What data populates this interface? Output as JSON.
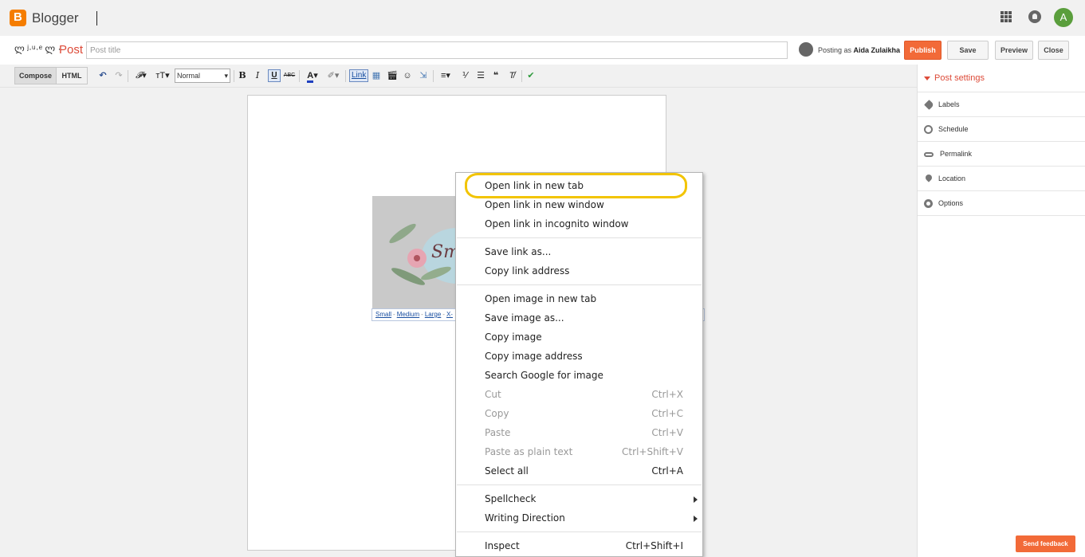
{
  "app": {
    "name": "Blogger",
    "logo_letter": "B",
    "avatar_letter": "A"
  },
  "title_row": {
    "blog_name": "ლ ʲ·ᵘ·ᵉ ლ ·",
    "crumb": "Post",
    "title_placeholder": "Post title",
    "posting_as_label": "Posting as",
    "user_name": "Aida Zulaikha",
    "publish": "Publish",
    "save": "Save",
    "preview": "Preview",
    "close": "Close"
  },
  "toolbar": {
    "compose": "Compose",
    "html": "HTML",
    "format_value": "Normal",
    "bold": "B",
    "italic": "I",
    "underline": "U",
    "strike": "ABC",
    "link": "Link"
  },
  "image_sizes": {
    "small": "Small",
    "medium": "Medium",
    "large": "Large",
    "xlarge_partial": "X-"
  },
  "sidebar": {
    "header": "Post settings",
    "items": [
      {
        "label": "Labels",
        "icon": "tag-icon"
      },
      {
        "label": "Schedule",
        "icon": "clock-icon"
      },
      {
        "label": "Permalink",
        "icon": "link-icon"
      },
      {
        "label": "Location",
        "icon": "pin-icon"
      },
      {
        "label": "Options",
        "icon": "gear-icon"
      }
    ]
  },
  "feedback": "Send feedback",
  "context_menu": {
    "open_link_new_tab": "Open link in new tab",
    "open_link_new_window": "Open link in new window",
    "open_link_incognito": "Open link in incognito window",
    "save_link_as": "Save link as...",
    "copy_link_address": "Copy link address",
    "open_image_new_tab": "Open image in new tab",
    "save_image_as": "Save image as...",
    "copy_image": "Copy image",
    "copy_image_address": "Copy image address",
    "search_google_image": "Search Google for image",
    "cut": "Cut",
    "cut_key": "Ctrl+X",
    "copy": "Copy",
    "copy_key": "Ctrl+C",
    "paste": "Paste",
    "paste_key": "Ctrl+V",
    "paste_plain": "Paste as plain text",
    "paste_plain_key": "Ctrl+Shift+V",
    "select_all": "Select all",
    "select_all_key": "Ctrl+A",
    "spellcheck": "Spellcheck",
    "writing_direction": "Writing Direction",
    "inspect": "Inspect",
    "inspect_key": "Ctrl+Shift+I"
  },
  "colors": {
    "accent": "#f26a38",
    "brand": "#f57d00",
    "highlight": "#f2c400",
    "crumb": "#dd4b39"
  }
}
